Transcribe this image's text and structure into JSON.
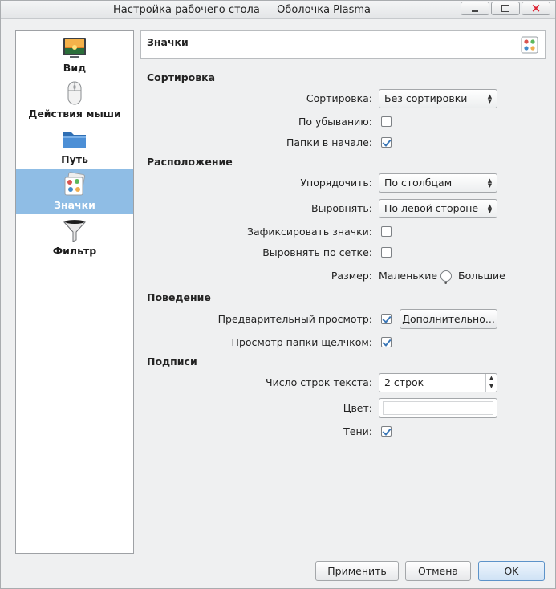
{
  "window": {
    "title": "Настройка рабочего стола — Оболочка Plasma"
  },
  "sidebar": {
    "items": [
      {
        "label": "Вид",
        "icon": "wallpaper-icon"
      },
      {
        "label": "Действия мыши",
        "icon": "mouse-icon"
      },
      {
        "label": "Путь",
        "icon": "folder-icon"
      },
      {
        "label": "Значки",
        "icon": "icons-icon",
        "active": true
      },
      {
        "label": "Фильтр",
        "icon": "funnel-icon"
      }
    ]
  },
  "header": {
    "title": "Значки"
  },
  "sorting": {
    "section": "Сортировка",
    "sort_label": "Сортировка:",
    "sort_value": "Без сортировки",
    "descending_label": "По убыванию:",
    "descending_checked": false,
    "folders_first_label": "Папки в начале:",
    "folders_first_checked": true
  },
  "arrangement": {
    "section": "Расположение",
    "arrange_label": "Упорядочить:",
    "arrange_value": "По столбцам",
    "align_label": "Выровнять:",
    "align_value": "По левой стороне",
    "lock_label": "Зафиксировать значки:",
    "lock_checked": false,
    "grid_label": "Выровнять по сетке:",
    "grid_checked": false,
    "size_label": "Размер:",
    "size_small": "Маленькие",
    "size_large": "Большие"
  },
  "behavior": {
    "section": "Поведение",
    "preview_label": "Предварительный просмотр:",
    "preview_checked": true,
    "more_button": "Дополнительно...",
    "popup_label": "Просмотр папки щелчком:",
    "popup_checked": true
  },
  "captions": {
    "section": "Подписи",
    "lines_label": "Число строк текста:",
    "lines_value": "2 строк",
    "color_label": "Цвет:",
    "shadow_label": "Тени:",
    "shadow_checked": true
  },
  "buttons": {
    "apply": "Применить",
    "cancel": "Отмена",
    "ok": "OK"
  }
}
